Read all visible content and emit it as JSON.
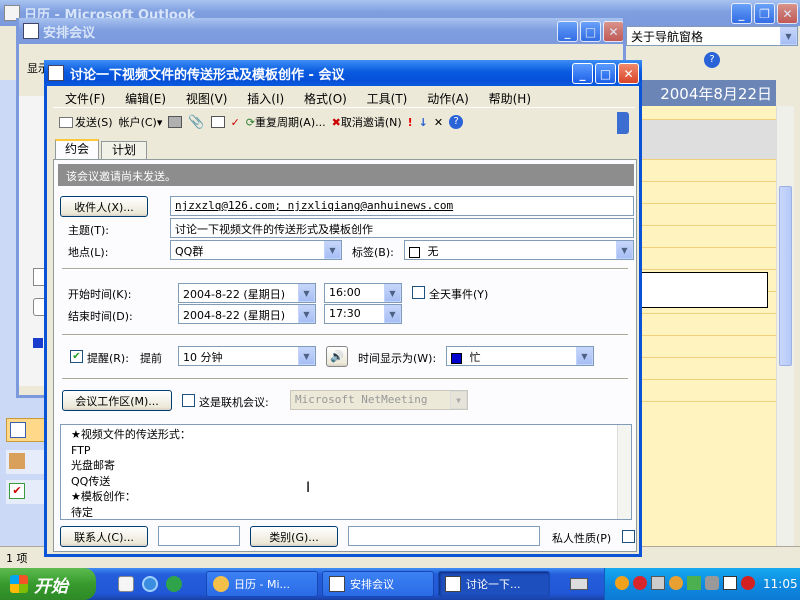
{
  "outlook": {
    "title": "日历 - Microsoft Outlook",
    "nav_text": "关于导航窗格",
    "date_header": "2004年8月22日",
    "status_items": "1 项"
  },
  "inner_dialog": {
    "title": "安排会议",
    "show_label": "显示"
  },
  "meeting": {
    "title": "讨论一下视频文件的传送形式及模板创作 - 会议",
    "menu": [
      "文件(F)",
      "编辑(E)",
      "视图(V)",
      "插入(I)",
      "格式(O)",
      "工具(T)",
      "动作(A)",
      "帮助(H)"
    ],
    "toolbar": {
      "send": "发送(S)",
      "account": "帐户(C)",
      "recurrence": "重复周期(A)...",
      "cancel_invite": "取消邀请(N)"
    },
    "tabs": [
      "约会",
      "计划"
    ],
    "info_bar": "该会议邀请尚未发送。",
    "to_button": "收件人(X)...",
    "to_value": "njzxzlq@126.com; njzxliqiang@anhuinews.com",
    "subject_label": "主题(T):",
    "subject_value": "讨论一下视频文件的传送形式及模板创作",
    "location_label": "地点(L):",
    "location_value": "QQ群",
    "label_label": "标签(B):",
    "label_value": "无",
    "start_label": "开始时间(K):",
    "start_date": "2004-8-22 (星期日)",
    "start_time": "16:00",
    "allday_label": "全天事件(Y)",
    "end_label": "结束时间(D):",
    "end_date": "2004-8-22 (星期日)",
    "end_time": "17:30",
    "reminder_label": "提醒(R):",
    "reminder_prefix": "提前",
    "reminder_value": "10 分钟",
    "reminder_checked": true,
    "showas_label": "时间显示为(W):",
    "showas_value": "忙",
    "showas_color": "#0000cc",
    "workspace_button": "会议工作区(M)...",
    "online_label": "这是联机会议:",
    "online_value": "Microsoft NetMeeting",
    "body_lines": [
      "★视频文件的传送形式：",
      "FTP",
      "光盘邮寄",
      "QQ传送",
      "★模板创作：",
      "待定"
    ],
    "contacts_button": "联系人(C)...",
    "categories_button": "类别(G)...",
    "private_label": "私人性质(P)"
  },
  "taskbar": {
    "start": "开始",
    "items": [
      "日历 - Mi...",
      "安排会议",
      "讨论一下..."
    ],
    "clock": "11:05"
  }
}
